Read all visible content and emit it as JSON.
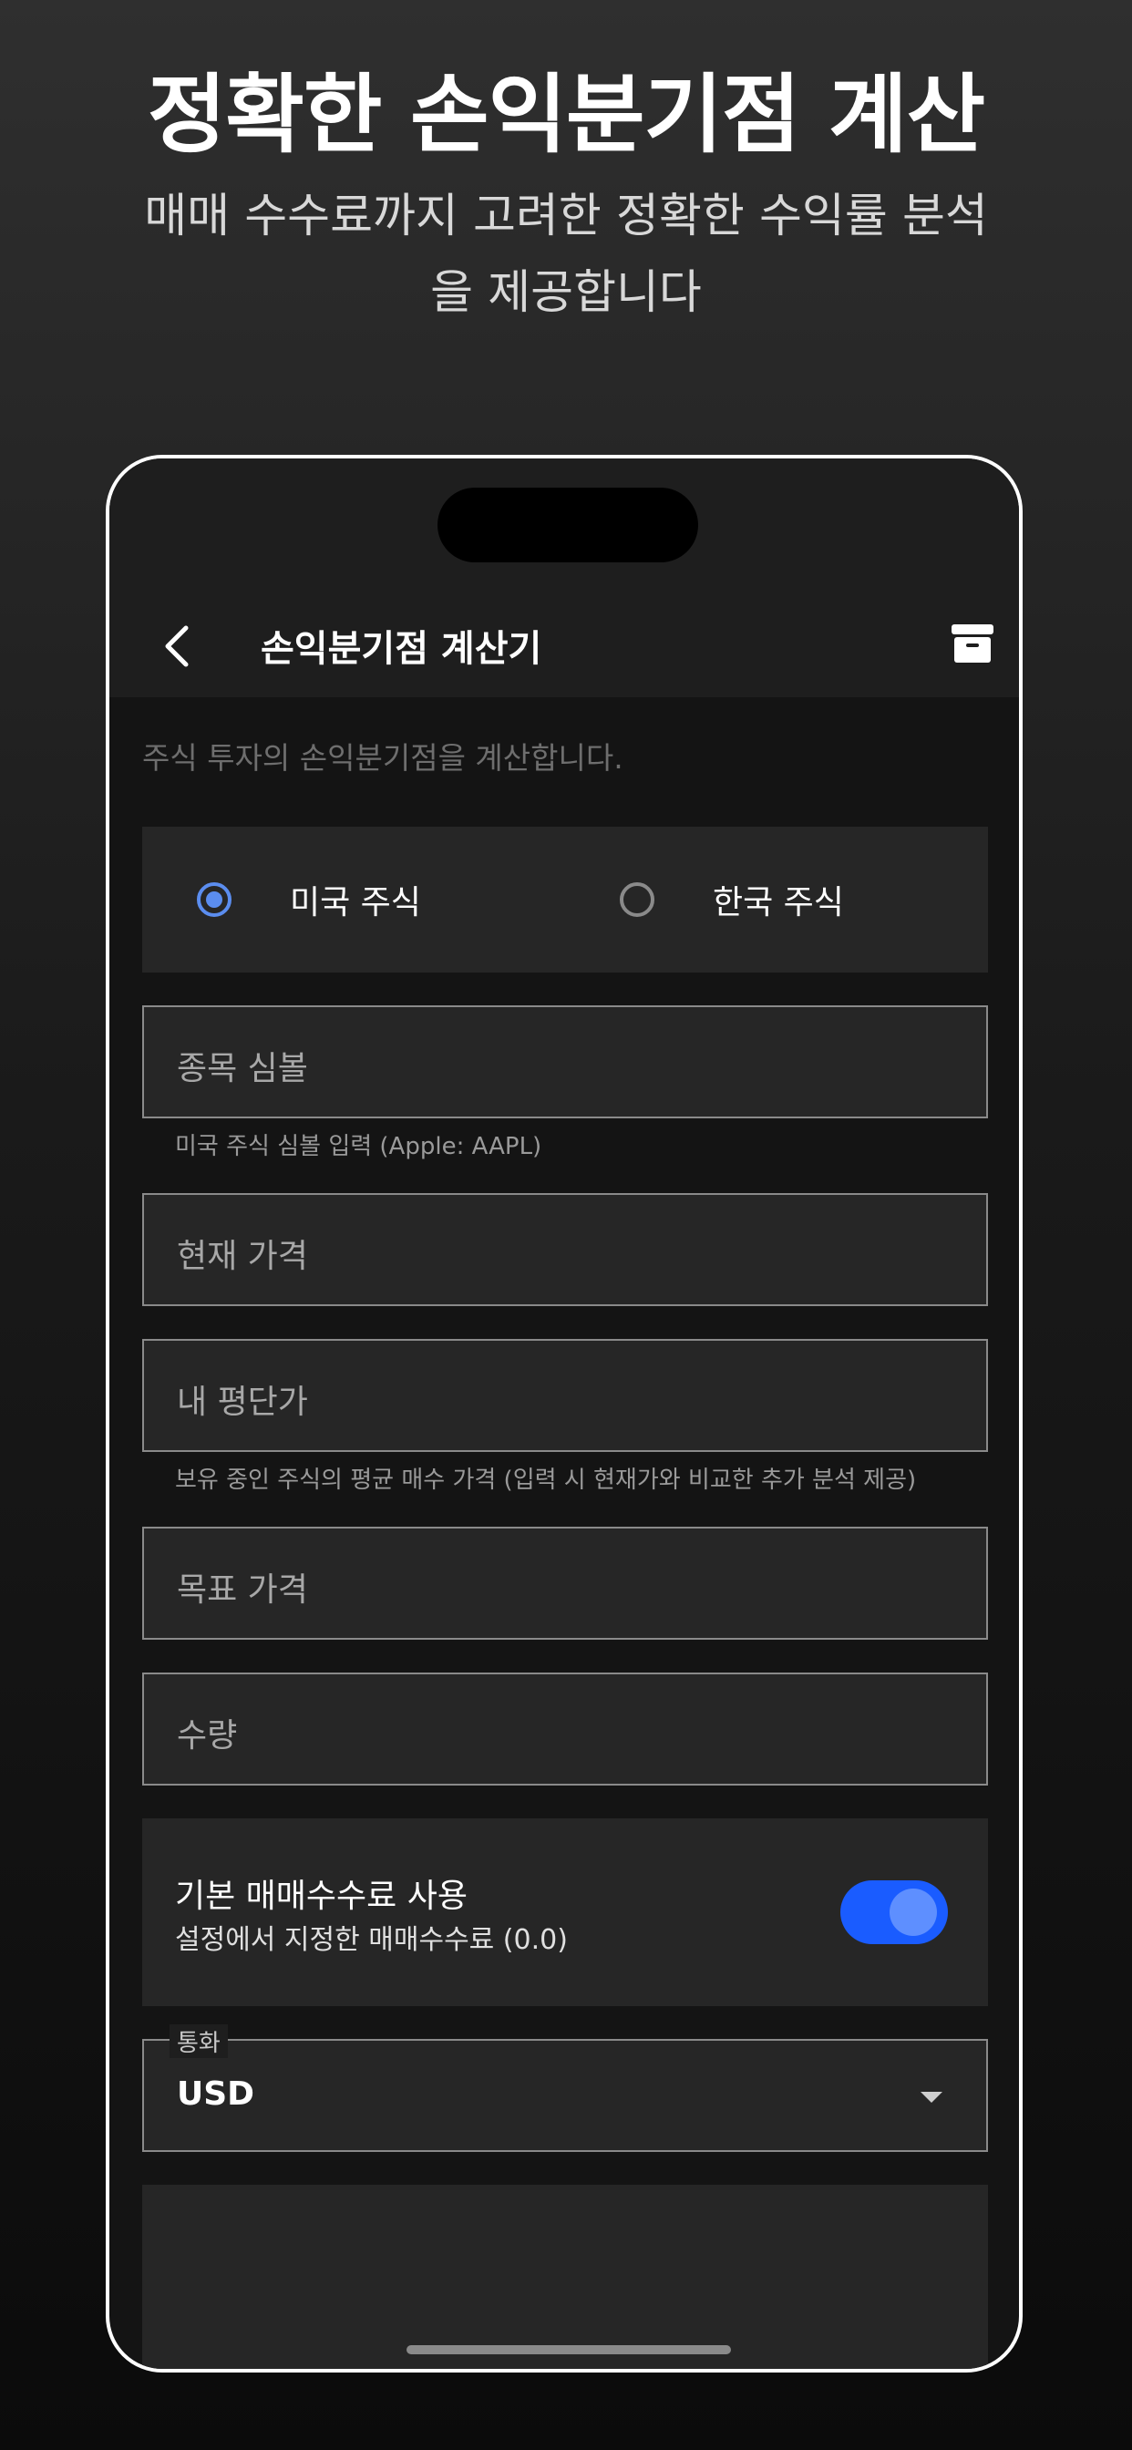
{
  "promo": {
    "headline": "정확한 손익분기점 계산",
    "subline": "매매 수수료까지 고려한 정확한 수익률 분석을 제공합니다"
  },
  "appbar": {
    "title": "손익분기점 계산기",
    "back_icon": "chevron-left-icon",
    "action_icon": "archive-icon"
  },
  "description": "주식 투자의 손익분기점을 계산합니다.",
  "market": {
    "options": [
      {
        "label": "미국 주식",
        "selected": true
      },
      {
        "label": "한국 주식",
        "selected": false
      }
    ]
  },
  "fields": {
    "symbol": {
      "placeholder": "종목 심볼",
      "helper": "미국 주식 심볼 입력 (Apple: AAPL)"
    },
    "current_price": {
      "placeholder": "현재 가격"
    },
    "avg_price": {
      "placeholder": "내 평단가",
      "helper": "보유 중인 주식의 평균 매수 가격 (입력 시 현재가와 비교한 추가 분석 제공)"
    },
    "target_price": {
      "placeholder": "목표 가격"
    },
    "quantity": {
      "placeholder": "수량"
    }
  },
  "fee": {
    "title": "기본 매매수수료 사용",
    "subtitle": "설정에서 지정한 매매수수료 (0.0)",
    "enabled": true
  },
  "currency": {
    "label": "통화",
    "value": "USD"
  },
  "colors": {
    "accent": "#5b8def",
    "toggle_track": "#1a5cff",
    "panel": "#262626"
  }
}
